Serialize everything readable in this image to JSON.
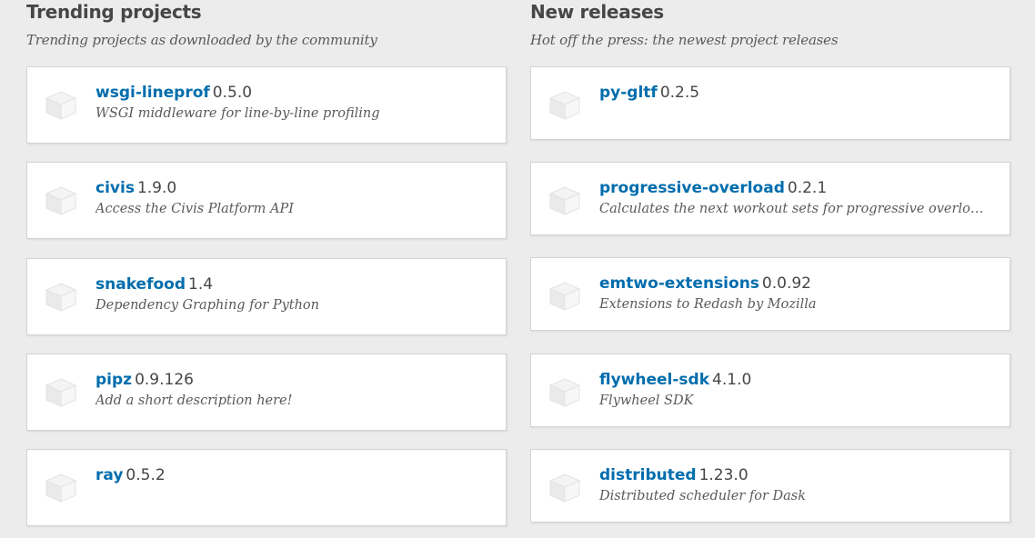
{
  "trending": {
    "title": "Trending projects",
    "subtitle": "Trending projects as downloaded by the community",
    "items": [
      {
        "name": "wsgi-lineprof",
        "version": "0.5.0",
        "description": "WSGI middleware for line-by-line profiling",
        "icon": "package-cube-icon"
      },
      {
        "name": "civis",
        "version": "1.9.0",
        "description": "Access the Civis Platform API",
        "icon": "package-cube-icon"
      },
      {
        "name": "snakefood",
        "version": "1.4",
        "description": "Dependency Graphing for Python",
        "icon": "package-cube-icon"
      },
      {
        "name": "pipz",
        "version": "0.9.126",
        "description": "Add a short description here!",
        "icon": "package-cube-icon"
      },
      {
        "name": "ray",
        "version": "0.5.2",
        "description": "",
        "icon": "package-cube-icon"
      }
    ]
  },
  "releases": {
    "title": "New releases",
    "subtitle": "Hot off the press: the newest project releases",
    "items": [
      {
        "name": "py-gltf",
        "version": "0.2.5",
        "description": "",
        "icon": "package-cube-icon"
      },
      {
        "name": "progressive-overload",
        "version": "0.2.1",
        "description": "Calculates the next workout sets for progressive overload given …",
        "icon": "package-cube-icon"
      },
      {
        "name": "emtwo-extensions",
        "version": "0.0.92",
        "description": "Extensions to Redash by Mozilla",
        "icon": "package-cube-icon"
      },
      {
        "name": "flywheel-sdk",
        "version": "4.1.0",
        "description": "Flywheel SDK",
        "icon": "package-cube-icon"
      },
      {
        "name": "distributed",
        "version": "1.23.0",
        "description": "Distributed scheduler for Dask",
        "icon": "package-cube-icon"
      }
    ]
  },
  "colors": {
    "background": "#ececec",
    "card": "#ffffff",
    "link": "#006dad",
    "text": "#464646"
  }
}
